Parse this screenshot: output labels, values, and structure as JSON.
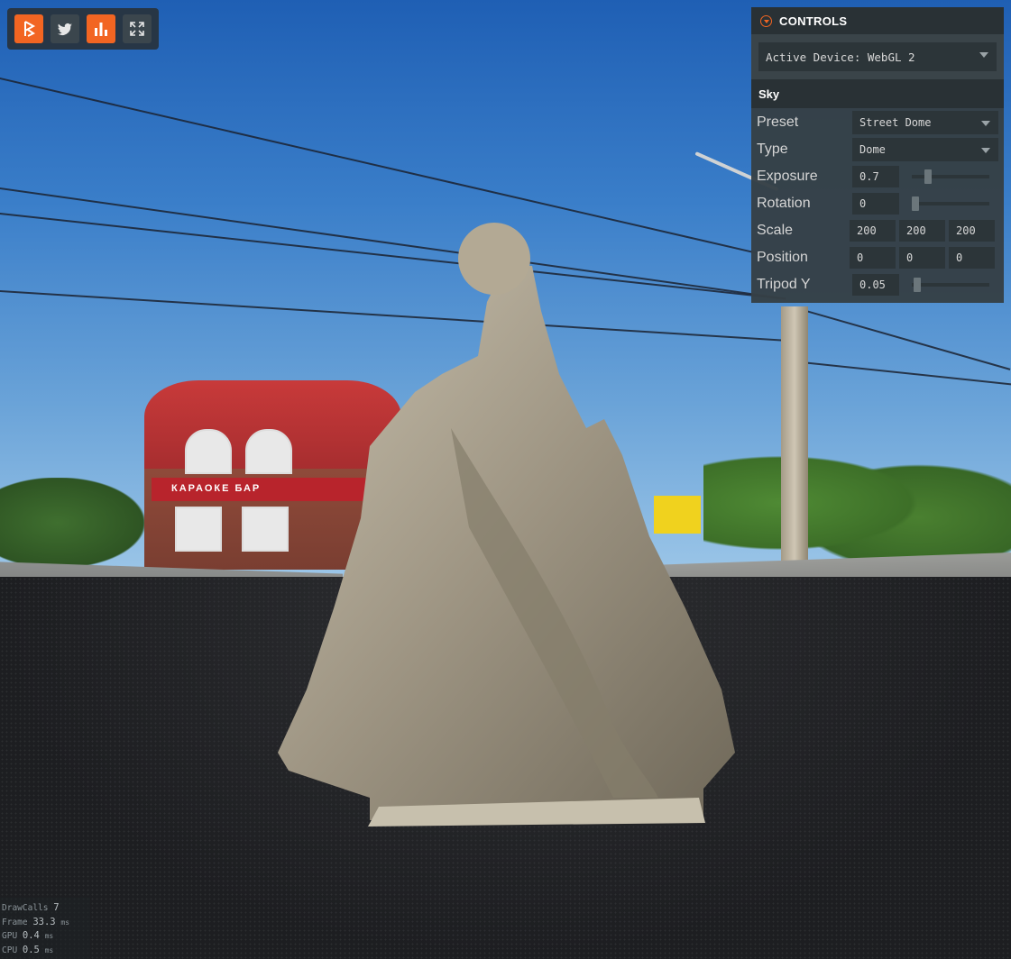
{
  "toolbar": {
    "buttons": [
      {
        "name": "playcanvas-logo",
        "icon": "playcanvas-icon",
        "active": true
      },
      {
        "name": "twitter",
        "icon": "twitter-icon",
        "active": false
      },
      {
        "name": "stats",
        "icon": "bar-chart-icon",
        "active": true
      },
      {
        "name": "fullscreen",
        "icon": "fullscreen-icon",
        "active": false
      }
    ]
  },
  "panel": {
    "title": "CONTROLS",
    "device": {
      "value": "Active Device: WebGL 2"
    },
    "section": "Sky",
    "rows": {
      "preset": {
        "label": "Preset",
        "value": "Street Dome"
      },
      "type": {
        "label": "Type",
        "value": "Dome"
      },
      "exposure": {
        "label": "Exposure",
        "value": "0.7",
        "slider_fraction": 0.18
      },
      "rotation": {
        "label": "Rotation",
        "value": "0",
        "slider_fraction": 0.0
      },
      "scale": {
        "label": "Scale",
        "x": "200",
        "y": "200",
        "z": "200"
      },
      "position": {
        "label": "Position",
        "x": "0",
        "y": "0",
        "z": "0"
      },
      "tripod": {
        "label": "Tripod Y",
        "value": "0.05",
        "slider_fraction": 0.02
      }
    }
  },
  "stats": {
    "draw_calls": {
      "label": "DrawCalls",
      "value": "7",
      "unit": ""
    },
    "frame": {
      "label": "Frame",
      "value": "33.3",
      "unit": "ms"
    },
    "gpu": {
      "label": "GPU",
      "value": "0.4",
      "unit": "ms"
    },
    "cpu": {
      "label": "CPU",
      "value": "0.5",
      "unit": "ms"
    }
  },
  "scene": {
    "sign_text": "КАРАОКЕ БАР",
    "colors": {
      "accent": "#f26522",
      "panel_bg": "#364046",
      "header_bg": "#293135"
    }
  }
}
